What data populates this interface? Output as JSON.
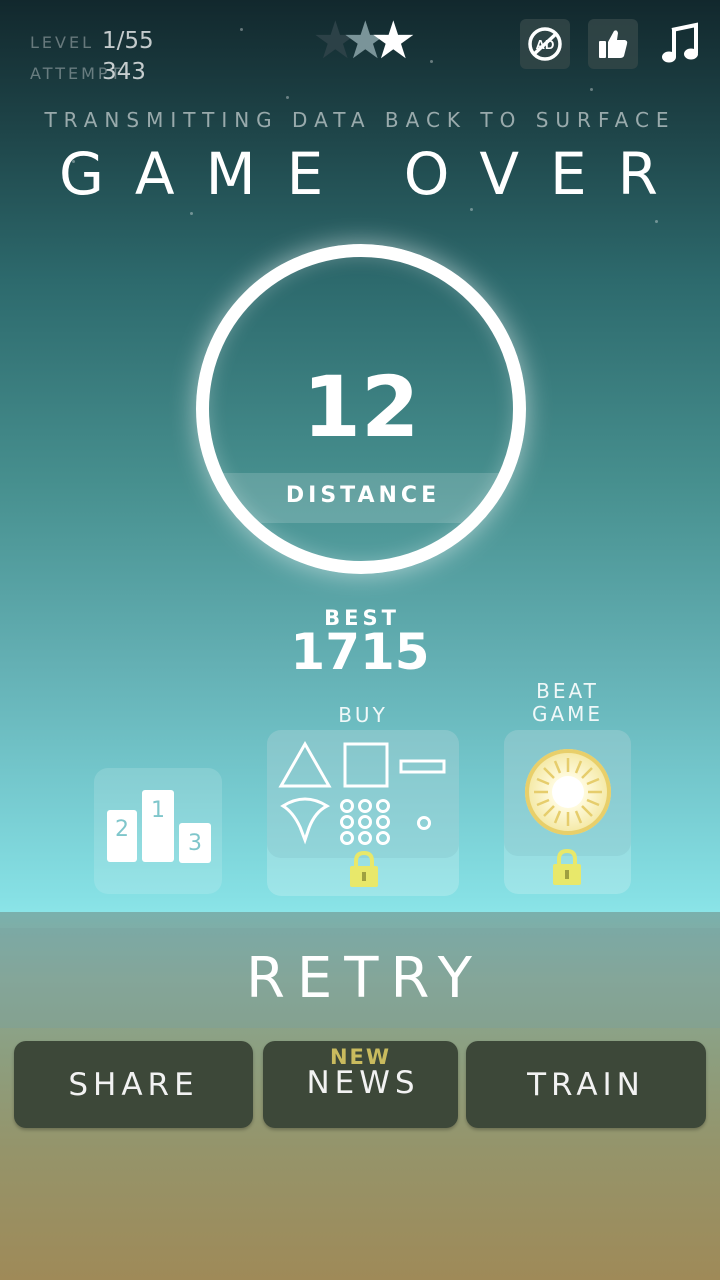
{
  "hud": {
    "level_label": "LEVEL",
    "level_value": "1/55",
    "attempt_label": "ATTEMPT",
    "attempt_value": "343",
    "stars_earned": 1,
    "stars_total": 3
  },
  "top_icons": [
    "no-ads-icon",
    "thumbs-up-icon",
    "music-note-icon"
  ],
  "header": {
    "subtitle": "TRANSMITTING DATA BACK TO SURFACE",
    "title": "GAME OVER"
  },
  "result": {
    "distance_value": "12",
    "distance_label": "DISTANCE",
    "best_label": "BEST",
    "best_value": "1715"
  },
  "panels": {
    "leaderboard": {
      "places": [
        "2",
        "1",
        "3"
      ]
    },
    "buy": {
      "label": "BUY",
      "locked": true
    },
    "beat_game": {
      "label_line1": "BEAT",
      "label_line2": "GAME",
      "locked": true
    }
  },
  "actions": {
    "retry": "RETRY",
    "share": "SHARE",
    "news_badge": "NEW",
    "news": "NEWS",
    "train": "TRAIN"
  },
  "colors": {
    "button_bg": "#3d4839",
    "news_badge": "#c9bb5e",
    "lock": "#e8e86a"
  }
}
